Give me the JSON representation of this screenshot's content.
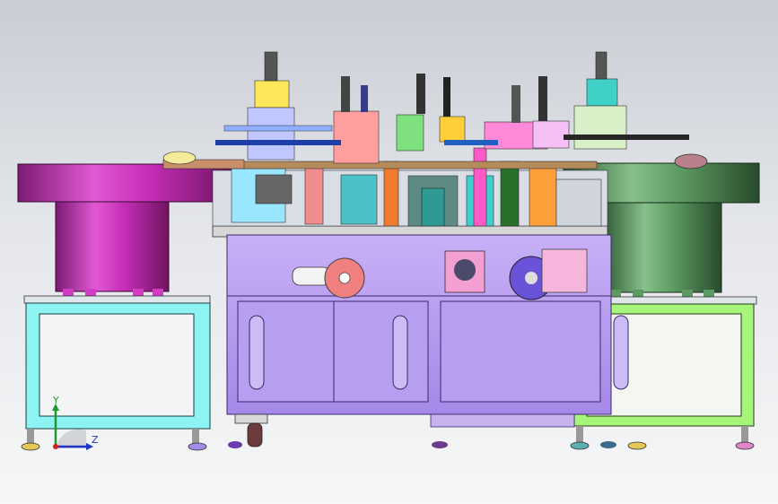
{
  "viewport": {
    "background_top": "#c9cdd4",
    "background_bottom": "#f6f7f8"
  },
  "model": {
    "left_feeder_color": "#c62fb8",
    "right_feeder_color": "#5c9a62",
    "left_stand_color": "#8ef3f3",
    "right_stand_color": "#a8f57c",
    "main_frame_color": "#b99cf2"
  },
  "triad": {
    "y_label": "Y",
    "z_label": "Z",
    "y_color": "#1f9a2a",
    "z_color": "#1f35c8",
    "origin_color": "#d41f1f"
  }
}
